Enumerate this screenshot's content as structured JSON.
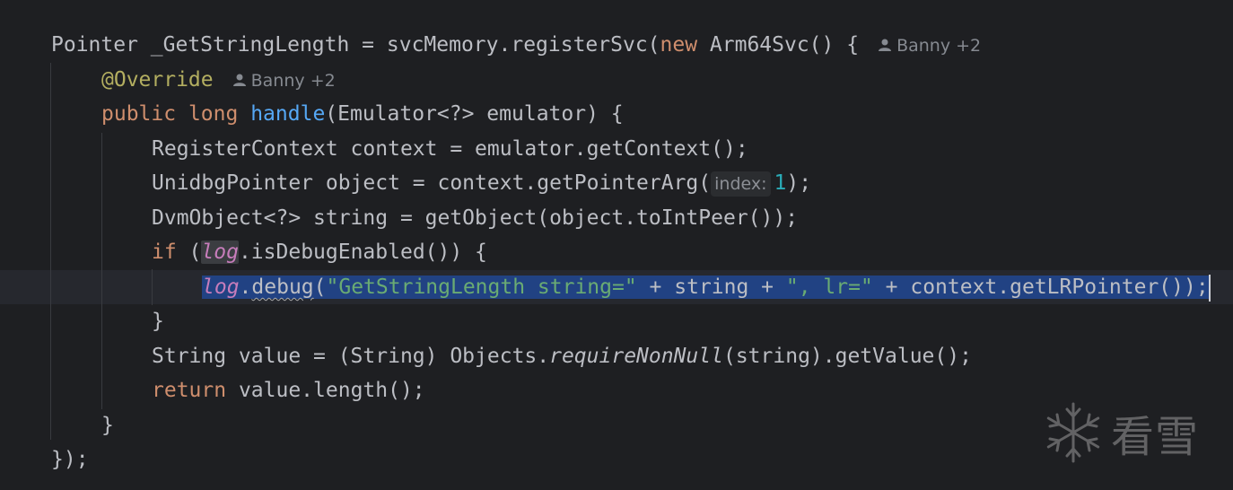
{
  "author_hint": {
    "name": "Banny",
    "extra": "+2"
  },
  "param_hint": "index:",
  "watermark": {
    "text": "看雪",
    "icon": "snowflake-icon"
  },
  "tokens": {
    "l1_a": "Pointer _GetStringLength = svcMemory.registerSvc(",
    "l1_new": "new",
    "l1_b": " Arm64Svc() {",
    "l2_anno": "@Override",
    "l3_public": "public",
    "l3_long": "long",
    "l3_handle": "handle",
    "l3_b": "(Emulator<?> emulator) {",
    "l4": "RegisterContext context = emulator.getContext();",
    "l5_a": "UnidbgPointer object = context.getPointerArg(",
    "l5_num": "1",
    "l5_b": ");",
    "l6": "DvmObject<?> string = getObject(object.toIntPeer());",
    "l7_if": "if",
    "l7_a": " (",
    "l7_log": "log",
    "l7_b": ".isDebugEnabled()) {",
    "l8_log": "log",
    "l8_dot": ".",
    "l8_debug": "debug",
    "l8_paren": "(",
    "l8_str1": "\"GetStringLength string=\"",
    "l8_mid": " + string + ",
    "l8_str2": "\", lr=\"",
    "l8_end": " + context.getLRPointer());",
    "l9": "}",
    "l10_a": "String value = (String) Objects.",
    "l10_it": "requireNonNull",
    "l10_b": "(string).getValue();",
    "l11_return": "return",
    "l11_b": " value.length();",
    "l12": "}",
    "l13": "});"
  },
  "colors": {
    "background": "#1e1f22",
    "keyword": "#cf8e6d",
    "annotation": "#b3ae60",
    "method_decl": "#56a8f5",
    "string": "#6aab73",
    "number": "#2aacb8",
    "static_field": "#c77dbb",
    "selection": "#214283"
  }
}
